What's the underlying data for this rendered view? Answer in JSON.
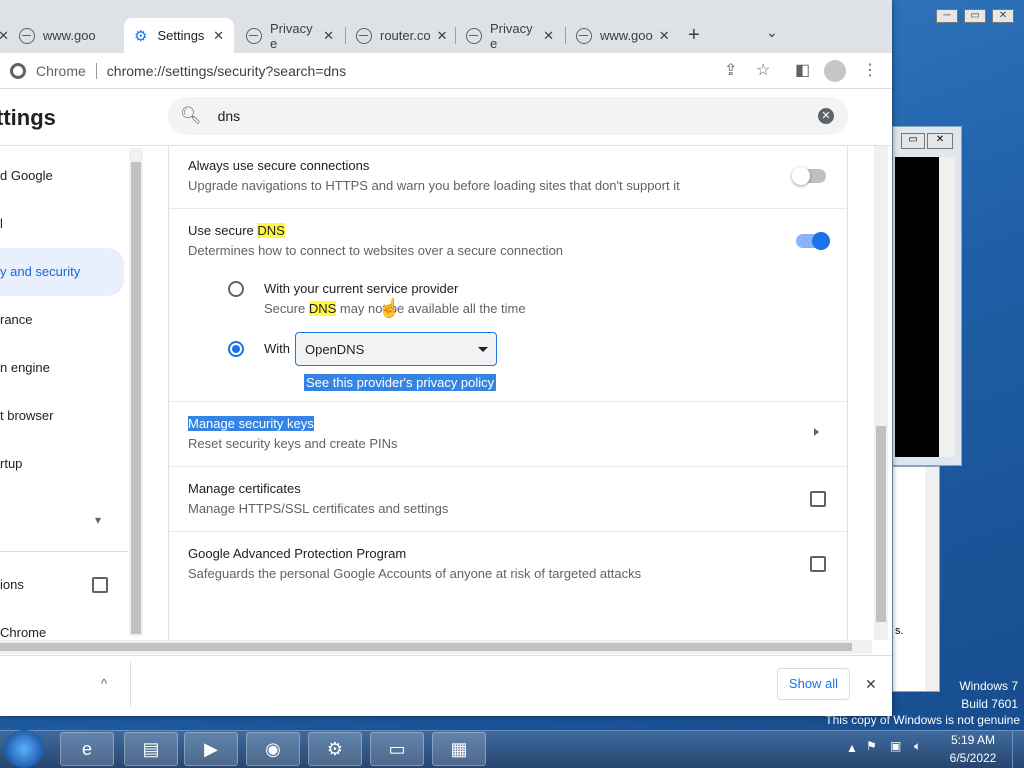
{
  "tabs": [
    {
      "label": "www.goo"
    },
    {
      "label": "Settings"
    },
    {
      "label": "Privacy e"
    },
    {
      "label": "router.co"
    },
    {
      "label": "Privacy e"
    },
    {
      "label": "www.goo"
    }
  ],
  "tab_close": "✕",
  "new_tab": "+",
  "tab_menu": "⌄",
  "window_buttons": {
    "minimize": "─",
    "restore": "▭",
    "close": "✕"
  },
  "omnibox": {
    "label": "Chrome",
    "url": "chrome://settings/security?search=dns"
  },
  "settings": {
    "title": "ttings",
    "search_value": "dns",
    "clear": "✕"
  },
  "sidebar": {
    "items": [
      {
        "label": "d Google"
      },
      {
        "label": "l"
      },
      {
        "label": "y and security"
      },
      {
        "label": "rance"
      },
      {
        "label": "n engine"
      },
      {
        "label": "t browser"
      },
      {
        "label": "rtup"
      },
      {
        "label": "ions"
      },
      {
        "label": "Chrome"
      }
    ],
    "expand": "▾"
  },
  "content": {
    "always_secure": {
      "title": "Always use secure connections",
      "desc": "Upgrade navigations to HTTPS and warn you before loading sites that don't support it",
      "enabled": false
    },
    "secure_dns": {
      "title_prefix": "Use secure ",
      "title_hl": "DNS",
      "desc": "Determines how to connect to websites over a secure connection",
      "enabled": true
    },
    "option_current": {
      "title": "With your current service provider",
      "desc_prefix": "Secure ",
      "desc_hl": "DNS",
      "desc_suffix": " may not be available all the time"
    },
    "option_with": {
      "label": "With",
      "provider": "OpenDNS",
      "privacy_link": "See this provider's privacy policy"
    },
    "security_keys": {
      "title": "Manage security keys",
      "desc": "Reset security keys and create PINs"
    },
    "certificates": {
      "title": "Manage certificates",
      "desc": "Manage HTTPS/SSL certificates and settings"
    },
    "advanced": {
      "title": "Google Advanced Protection Program",
      "desc": "Safeguards the personal Google Accounts of anyone at risk of targeted attacks"
    }
  },
  "downloads": {
    "show_all": "Show all",
    "close": "✕",
    "expand": "^"
  },
  "desktop": {
    "watermark1": "Windows 7",
    "watermark2": "Build 7601",
    "watermark3": "This copy of Windows is not genuine",
    "side_text": "s."
  },
  "tray": {
    "time": "5:19 AM",
    "date": "6/5/2022"
  },
  "colors": {
    "accent": "#1a73e8",
    "highlight": "#fff740",
    "selection": "#3584e4"
  }
}
